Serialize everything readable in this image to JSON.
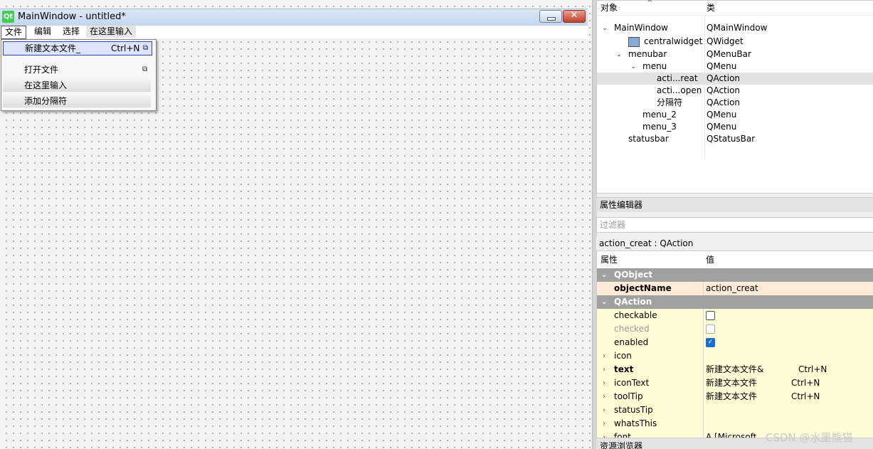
{
  "window": {
    "title": "MainWindow - untitled*",
    "logo": "Qt"
  },
  "menubar": {
    "file": "文件",
    "edit": "编辑",
    "select": "选择",
    "type_here": "在这里输入"
  },
  "dropdown": {
    "new_file": {
      "label": "新建文本文件_",
      "shortcut": "Ctrl+N"
    },
    "open_file": {
      "label": "打开文件"
    },
    "type_here": {
      "label": "在这里输入"
    },
    "add_separator": {
      "label": "添加分隔符"
    }
  },
  "object_inspector": {
    "headers": {
      "object": "对象",
      "class": "类"
    },
    "rows": [
      {
        "name": "MainWindow",
        "class": "QMainWindow"
      },
      {
        "name": "centralwidget",
        "class": "QWidget"
      },
      {
        "name": "menubar",
        "class": "QMenuBar"
      },
      {
        "name": "menu",
        "class": "QMenu"
      },
      {
        "name": "acti...reat",
        "class": "QAction"
      },
      {
        "name": "acti...open",
        "class": "QAction"
      },
      {
        "name": "分隔符",
        "class": "QAction"
      },
      {
        "name": "menu_2",
        "class": "QMenu"
      },
      {
        "name": "menu_3",
        "class": "QMenu"
      },
      {
        "name": "statusbar",
        "class": "QStatusBar"
      }
    ]
  },
  "property_editor": {
    "dock_title": "属性编辑器",
    "filter_placeholder": "过滤器",
    "object_title": "action_creat : QAction",
    "headers": {
      "property": "属性",
      "value": "值"
    },
    "groups": {
      "qobject": "QObject",
      "qaction": "QAction"
    },
    "props": {
      "objectName": {
        "name": "objectName",
        "value": "action_creat"
      },
      "checkable": {
        "name": "checkable"
      },
      "checked": {
        "name": "checked"
      },
      "enabled": {
        "name": "enabled"
      },
      "icon": {
        "name": "icon"
      },
      "text": {
        "name": "text",
        "value": "新建文本文件&",
        "shortcut": "Ctrl+N"
      },
      "iconText": {
        "name": "iconText",
        "value": "新建文本文件",
        "shortcut": "Ctrl+N"
      },
      "toolTip": {
        "name": "toolTip",
        "value": "新建文本文件",
        "shortcut": "Ctrl+N"
      },
      "statusTip": {
        "name": "statusTip"
      },
      "whatsThis": {
        "name": "whatsThis"
      },
      "font": {
        "name": "font",
        "value": "A [Microsoft"
      }
    }
  },
  "resource_browser": {
    "title": "资源浏览器"
  },
  "watermark": "CSDN @水墨熊猫"
}
